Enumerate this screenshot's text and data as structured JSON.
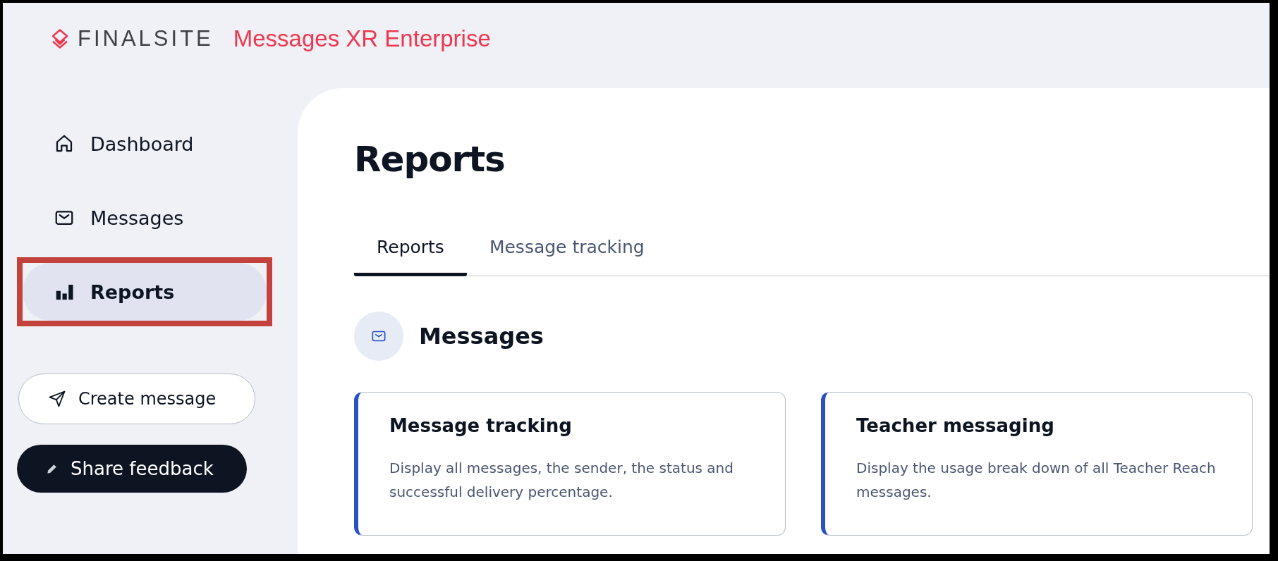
{
  "header": {
    "brand": "FINALSITE",
    "product": "Messages XR Enterprise"
  },
  "sidebar": {
    "items": [
      {
        "label": "Dashboard",
        "selected": false,
        "highlighted": false
      },
      {
        "label": "Messages",
        "selected": false,
        "highlighted": false
      },
      {
        "label": "Reports",
        "selected": true,
        "highlighted": true
      }
    ],
    "buttons": [
      {
        "label": "Create message",
        "kind": "outline"
      },
      {
        "label": "Share feedback",
        "kind": "dark"
      }
    ]
  },
  "page": {
    "title": "Reports",
    "tabs": [
      {
        "label": "Reports",
        "selected": true
      },
      {
        "label": "Message tracking",
        "selected": false
      }
    ],
    "section": {
      "title": "Messages"
    },
    "cards": [
      {
        "title": "Message tracking",
        "description": "Display all messages, the sender, the status and successful delivery percentage."
      },
      {
        "title": "Teacher messaging",
        "description": "Display the usage break down of all Teacher Reach messages."
      }
    ]
  }
}
